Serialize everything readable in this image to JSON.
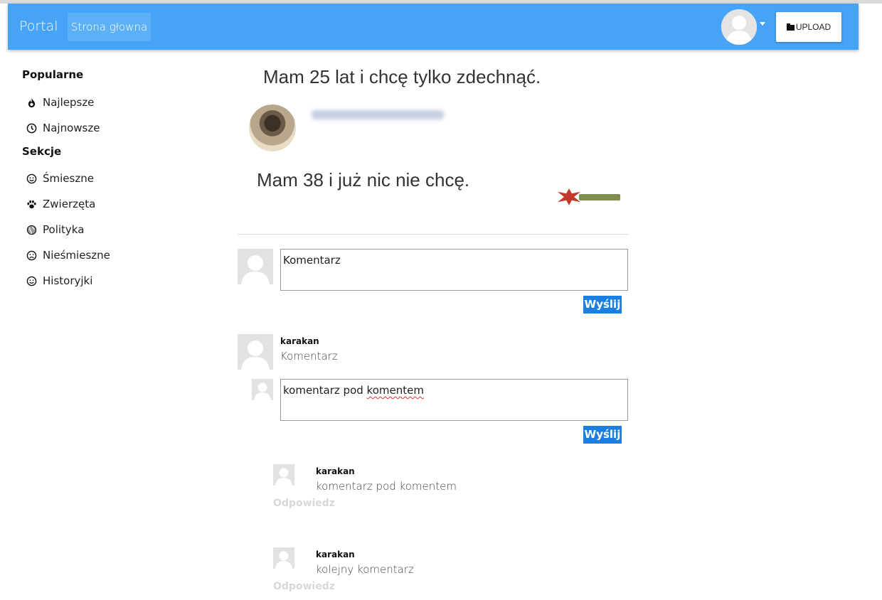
{
  "navbar": {
    "brand": "Portal",
    "home_link": "Strona głowna",
    "upload_label": "UPLOAD",
    "accent_color": "#46a3f5"
  },
  "sidebar": {
    "popular_heading": "Popularne",
    "popular_items": [
      {
        "label": "Najlepsze",
        "icon": "fire-icon"
      },
      {
        "label": "Najnowsze",
        "icon": "clock-icon"
      }
    ],
    "sections_heading": "Sekcje",
    "section_items": [
      {
        "label": "Śmieszne",
        "icon": "smile-icon"
      },
      {
        "label": "Zwierzęta",
        "icon": "paw-icon"
      },
      {
        "label": "Polityka",
        "icon": "globe-icon"
      },
      {
        "label": "Nieśmieszne",
        "icon": "frown-icon"
      },
      {
        "label": "Historyjki",
        "icon": "smile-icon"
      }
    ]
  },
  "post": {
    "line1": "Mam 25 lat i chcę tylko zdechnąć.",
    "line2": "Mam 38 i już nic nie chcę."
  },
  "new_comment": {
    "value": "Komentarz",
    "send_label": "Wyślij"
  },
  "comments": [
    {
      "author": "karakan",
      "text": "Komentarz",
      "reply_box": {
        "value_plain": "komentarz pod ",
        "value_misspelled": "komentem",
        "send_label": "Wyślij"
      },
      "replies": [
        {
          "author": "karakan",
          "text": "komentarz pod komentem",
          "reply_label": "Odpowiedz"
        },
        {
          "author": "karakan",
          "text": "kolejny komentarz",
          "reply_label": "Odpowiedz"
        }
      ]
    }
  ]
}
